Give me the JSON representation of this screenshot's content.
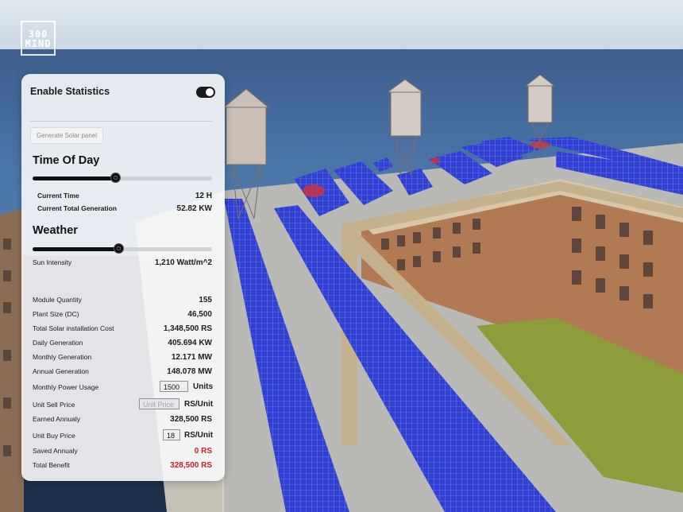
{
  "logo": {
    "line1": "300",
    "line2": "MIND"
  },
  "panel": {
    "enable_label": "Enable Statistics",
    "enable_on": true,
    "generate_button": "Generate Solar panel",
    "time": {
      "title": "Time Of Day",
      "slider_fraction": 0.46,
      "current_time_label": "Current Time",
      "current_time_value": "12 H",
      "total_gen_label": "Current Total Generation",
      "total_gen_value": "52.82 KW"
    },
    "weather": {
      "title": "Weather",
      "slider_fraction": 0.48,
      "sun_label": "Sun Intensity",
      "sun_value": "1,210 Watt/m^2"
    },
    "stats": {
      "module_qty_label": "Module Quantity",
      "module_qty_value": "155",
      "plant_size_label": "Plant Size (DC)",
      "plant_size_value": "46,500",
      "install_cost_label": "Total Solar installation Cost",
      "install_cost_value": "1,348,500 RS",
      "daily_gen_label": "Daily Generation",
      "daily_gen_value": "405.694 KW",
      "monthly_gen_label": "Monthly Generation",
      "monthly_gen_value": "12.171 MW",
      "annual_gen_label": "Annual Generation",
      "annual_gen_value": "148.078 MW",
      "monthly_usage_label": "Monthly Power Usage",
      "monthly_usage_value": "1500",
      "monthly_usage_unit": "Units",
      "sell_price_label": "Unit Sell Price",
      "sell_price_placeholder": "Unit Price",
      "sell_price_unit": "RS/Unit",
      "earned_label": "Earned Annualy",
      "earned_value": "328,500 RS",
      "buy_price_label": "Unit Buy Price",
      "buy_price_value": "18",
      "buy_price_unit": "RS/Unit",
      "saved_label": "Saved Annualy",
      "saved_value": "0 RS",
      "benefit_label": "Total Benefit",
      "benefit_value": "328,500 RS"
    }
  },
  "colors": {
    "accent": "#111111",
    "negative": "#c8202a",
    "panel_blue": "#2e3fcf"
  }
}
